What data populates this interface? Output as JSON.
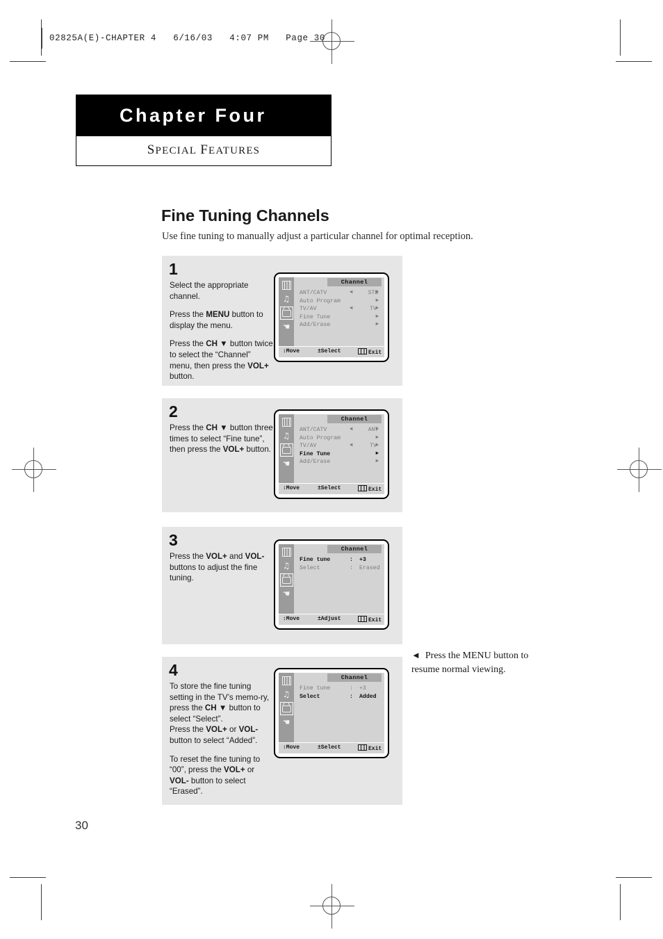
{
  "file_header": "02825A(E)-CHAPTER 4   6/16/03   4:07 PM   Page 30",
  "chapter": {
    "title": "Chapter Four",
    "subtitle_first": "S",
    "subtitle_rest1": "PECIAL",
    "subtitle_second": "F",
    "subtitle_rest2": "EATURES",
    "subtitle_full": "SPECIAL FEATURES"
  },
  "section": {
    "title": "Fine Tuning Channels",
    "intro": "Use fine tuning to manually adjust a particular channel for optimal reception."
  },
  "steps": [
    {
      "number": "1",
      "lines": [
        [
          {
            "t": "Select the appropriate channel."
          }
        ],
        [
          {
            "t": "Press the "
          },
          {
            "t": "MENU",
            "b": true
          },
          {
            "t": " button to display the menu."
          }
        ],
        [
          {
            "t": "Press the "
          },
          {
            "t": "CH ▼",
            "b": true
          },
          {
            "t": " button twice to select the “Channel” menu, then press the "
          },
          {
            "t": "VOL+",
            "b": true
          },
          {
            "t": " button."
          }
        ]
      ]
    },
    {
      "number": "2",
      "lines": [
        [
          {
            "t": "Press the "
          },
          {
            "t": "CH ▼",
            "b": true
          },
          {
            "t": " button three times to select “Fine tune”, then press the "
          },
          {
            "t": "VOL+",
            "b": true
          },
          {
            "t": " button."
          }
        ]
      ]
    },
    {
      "number": "3",
      "lines": [
        [
          {
            "t": "Press the "
          },
          {
            "t": "VOL+",
            "b": true
          },
          {
            "t": " and "
          },
          {
            "t": "VOL-",
            "b": true
          },
          {
            "t": " buttons to adjust the fine tuning."
          }
        ]
      ]
    },
    {
      "number": "4",
      "lines": [
        [
          {
            "t": "To store the fine tuning setting in the TV’s memo-ry, press the "
          },
          {
            "t": "CH ▼",
            "b": true
          },
          {
            "t": " button to select “Select”."
          },
          {
            "t": "\n"
          },
          {
            "t": "Press the "
          },
          {
            "t": "VOL+",
            "b": true
          },
          {
            "t": " or "
          },
          {
            "t": "VOL-",
            "b": true
          },
          {
            "t": " button to select “Added”."
          }
        ],
        [
          {
            "t": "To reset the fine tuning to “00”, press the "
          },
          {
            "t": "VOL+",
            "b": true
          },
          {
            "t": " or "
          },
          {
            "t": "VOL-",
            "b": true
          },
          {
            "t": " button to select “Erased”."
          }
        ]
      ]
    }
  ],
  "osd_icons": [
    "picture-bars-icon",
    "music-note-icon",
    "tv-set-icon",
    "hand-icon"
  ],
  "osd_screens": [
    {
      "title": "Channel",
      "selected_icon_index": 2,
      "rows": [
        {
          "label": "ANT/CATV",
          "value": "STD",
          "left_arrow": "◄",
          "right_arrow": "►",
          "active": false
        },
        {
          "label": "Auto Program",
          "value": "",
          "left_arrow": "",
          "right_arrow": "►",
          "active": false
        },
        {
          "label": "TV/AV",
          "value": "TV",
          "left_arrow": "◄",
          "right_arrow": "►",
          "active": false
        },
        {
          "label": "Fine Tune",
          "value": "",
          "left_arrow": "",
          "right_arrow": "►",
          "active": false
        },
        {
          "label": "Add/Erase",
          "value": "",
          "left_arrow": "",
          "right_arrow": "►",
          "active": false
        }
      ],
      "footer": {
        "move": "↕Move",
        "mid": "±Select",
        "exit": "Exit"
      }
    },
    {
      "title": "Channel",
      "selected_icon_index": 2,
      "rows": [
        {
          "label": "ANT/CATV",
          "value": "ANT",
          "left_arrow": "◄",
          "right_arrow": "►",
          "active": false
        },
        {
          "label": "Auto Program",
          "value": "",
          "left_arrow": "",
          "right_arrow": "►",
          "active": false
        },
        {
          "label": "TV/AV",
          "value": "TV",
          "left_arrow": "◄",
          "right_arrow": "►",
          "active": false
        },
        {
          "label": "Fine Tune",
          "value": "",
          "left_arrow": "",
          "right_arrow": "►",
          "active": true
        },
        {
          "label": "Add/Erase",
          "value": "",
          "left_arrow": "",
          "right_arrow": "►",
          "active": false
        }
      ],
      "footer": {
        "move": "↕Move",
        "mid": "±Select",
        "exit": "Exit"
      }
    },
    {
      "title": "Channel",
      "selected_icon_index": 2,
      "rows": [
        {
          "label": "Fine tune",
          "colon": ":",
          "value2": "+3",
          "active": true
        },
        {
          "label": "Select",
          "colon": ":",
          "value2": "Erased",
          "active": false
        }
      ],
      "footer": {
        "move": "↕Move",
        "mid": "±Adjust",
        "exit": "Exit"
      }
    },
    {
      "title": "Channel",
      "selected_icon_index": 2,
      "rows": [
        {
          "label": "Fine tune",
          "colon": ":",
          "value2": "+3",
          "active": false
        },
        {
          "label": "Select",
          "colon": ":",
          "value2": "Added",
          "active": true
        }
      ],
      "footer": {
        "move": "↕Move",
        "mid": "±Select",
        "exit": "Exit"
      }
    }
  ],
  "side_note": {
    "arrow": "◄",
    "text": "Press the MENU button to resume normal viewing."
  },
  "page_number": "30"
}
